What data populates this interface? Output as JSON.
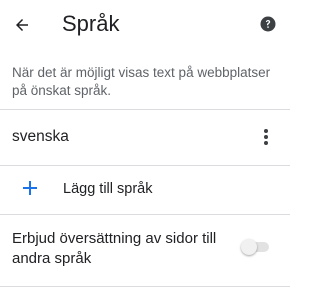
{
  "header": {
    "title": "Språk",
    "back_icon": "arrow-left-icon",
    "help_icon": "help-circle-icon"
  },
  "intro": {
    "text": "När det är möjligt visas text på webbplatser på önskat språk."
  },
  "languages": {
    "items": [
      {
        "label": "svenska",
        "menu_icon": "more-vert-icon"
      }
    ]
  },
  "add_language": {
    "label": "Lägg till språk",
    "icon": "plus-icon"
  },
  "translate_setting": {
    "label": "Erbjud översättning av sidor till andra språk",
    "enabled": false
  },
  "colors": {
    "accent": "#1a73e8",
    "divider": "#dadce0",
    "secondary_text": "#5f6368"
  }
}
